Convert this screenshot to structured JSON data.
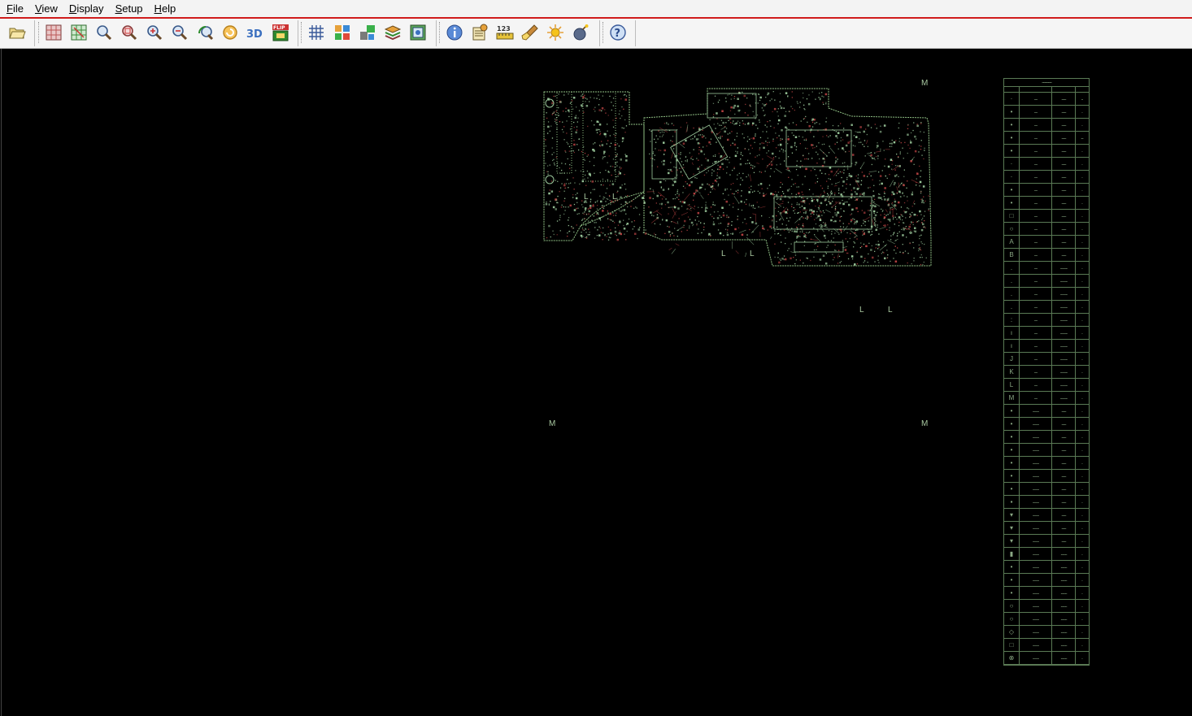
{
  "menu": [
    {
      "label": "File",
      "key": "F",
      "rest": "ile"
    },
    {
      "label": "View",
      "key": "V",
      "rest": "iew"
    },
    {
      "label": "Display",
      "key": "D",
      "rest": "isplay"
    },
    {
      "label": "Setup",
      "key": "S",
      "rest": "etup"
    },
    {
      "label": "Help",
      "key": "H",
      "rest": "elp"
    }
  ],
  "toolbar": {
    "groups": [
      [
        "open-folder-icon"
      ],
      [
        "grid-view-icon",
        "grid-fit-icon",
        "zoom-area-icon",
        "zoom-window-icon",
        "zoom-in-icon",
        "zoom-out-icon",
        "undo-view-icon",
        "redo-view-icon",
        "3d-view-icon",
        "flip-board-icon"
      ],
      [
        "grid-icon",
        "components-icon",
        "component-layout-icon",
        "layers-icon",
        "board-outline-icon"
      ],
      [
        "info-icon",
        "properties-icon",
        "measure-icon",
        "highlight-brush-icon",
        "brightness-icon",
        "bomb-icon"
      ],
      [
        "help-icon"
      ]
    ],
    "flip_label": "FLIP",
    "threed_label": "3D",
    "measure_label": "123"
  },
  "canvas": {
    "markers": [
      {
        "text": "M"
      },
      {
        "text": "M"
      },
      {
        "text": "M"
      },
      {
        "text": "L"
      },
      {
        "text": "L"
      },
      {
        "text": "L"
      },
      {
        "text": "L"
      },
      {
        "text": "L"
      },
      {
        "text": "L"
      }
    ]
  },
  "layer_table": {
    "header": "..................",
    "rows": [
      {
        "sym": "·",
        "a": "....",
        "b": "......",
        "c": ".."
      },
      {
        "sym": "•",
        "a": "....",
        "b": "......",
        "c": "."
      },
      {
        "sym": "•",
        "a": "....",
        "b": "......",
        "c": "."
      },
      {
        "sym": "•",
        "a": "....",
        "b": "......",
        "c": "..."
      },
      {
        "sym": "•",
        "a": "....",
        "b": "......",
        "c": "."
      },
      {
        "sym": "·",
        "a": "....",
        "b": "......",
        "c": "."
      },
      {
        "sym": "·",
        "a": "....",
        "b": "......",
        "c": "."
      },
      {
        "sym": "•",
        "a": "....",
        "b": "......",
        "c": "."
      },
      {
        "sym": "•",
        "a": "....",
        "b": "......",
        "c": "."
      },
      {
        "sym": "□",
        "a": "....",
        "b": "......",
        "c": "."
      },
      {
        "sym": "○",
        "a": "....",
        "b": "......",
        "c": "."
      },
      {
        "sym": "A",
        "a": "....",
        "b": "......",
        "c": "."
      },
      {
        "sym": "B",
        "a": "....",
        "b": "......",
        "c": "."
      },
      {
        "sym": ".",
        "a": "....",
        "b": ".........",
        "c": "."
      },
      {
        "sym": ".",
        "a": "....",
        "b": ".........",
        "c": "."
      },
      {
        "sym": ".",
        "a": "....",
        "b": ".........",
        "c": "."
      },
      {
        "sym": ".",
        "a": "....",
        "b": ".........",
        "c": "."
      },
      {
        "sym": ":",
        "a": "....",
        "b": ".........",
        "c": "."
      },
      {
        "sym": "ı",
        "a": "....",
        "b": ".........",
        "c": "."
      },
      {
        "sym": "ı",
        "a": "....",
        "b": ".........",
        "c": "."
      },
      {
        "sym": "J",
        "a": "....",
        "b": ".........",
        "c": "."
      },
      {
        "sym": "K",
        "a": "....",
        "b": ".........",
        "c": "."
      },
      {
        "sym": "L",
        "a": "....",
        "b": ".........",
        "c": "."
      },
      {
        "sym": "M",
        "a": "....",
        "b": ".........",
        "c": "."
      },
      {
        "sym": "•",
        "a": "........",
        "b": "......",
        "c": "."
      },
      {
        "sym": "•",
        "a": "........",
        "b": "......",
        "c": "."
      },
      {
        "sym": "•",
        "a": "........",
        "b": "......",
        "c": "."
      },
      {
        "sym": "•",
        "a": "........",
        "b": "......",
        "c": "."
      },
      {
        "sym": "•",
        "a": "........",
        "b": "......",
        "c": "."
      },
      {
        "sym": "•",
        "a": "........",
        "b": "......",
        "c": "."
      },
      {
        "sym": "•",
        "a": "........",
        "b": "......",
        "c": "."
      },
      {
        "sym": "▪",
        "a": "........",
        "b": "......",
        "c": "."
      },
      {
        "sym": "▾",
        "a": "........",
        "b": "......",
        "c": "."
      },
      {
        "sym": "▾",
        "a": "........",
        "b": "......",
        "c": "."
      },
      {
        "sym": "▾",
        "a": "........",
        "b": "......",
        "c": "."
      },
      {
        "sym": "▮",
        "a": "........",
        "b": "........",
        "c": "."
      },
      {
        "sym": "•",
        "a": "........",
        "b": "........",
        "c": "."
      },
      {
        "sym": "•",
        "a": "........",
        "b": "........",
        "c": "."
      },
      {
        "sym": "•",
        "a": "........",
        "b": "........",
        "c": "."
      },
      {
        "sym": "○",
        "a": "........",
        "b": "........",
        "c": "."
      },
      {
        "sym": "○",
        "a": "........",
        "b": "........",
        "c": "."
      },
      {
        "sym": "◇",
        "a": "........",
        "b": "........",
        "c": "."
      },
      {
        "sym": "□",
        "a": "........",
        "b": "........",
        "c": "."
      },
      {
        "sym": "⊗",
        "a": "........",
        "b": "........",
        "c": "."
      }
    ]
  },
  "colors": {
    "board_outline": "#8fbf84",
    "board_traces": "#9ac79a",
    "parts_red": "#b34040",
    "menubar_accent": "#d01b1b",
    "table_line": "#5a7a55"
  }
}
